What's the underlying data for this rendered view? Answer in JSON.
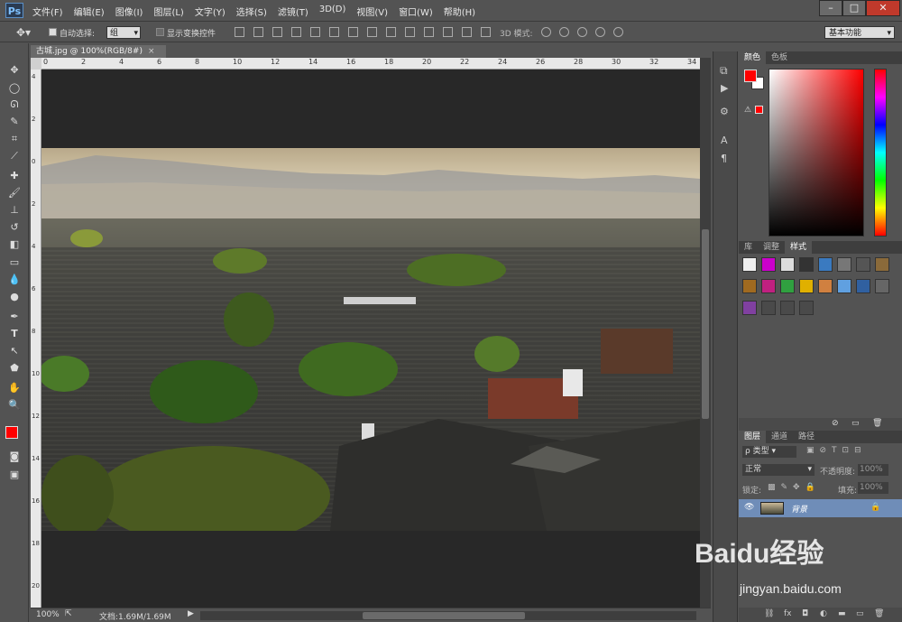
{
  "app": {
    "logo": "Ps"
  },
  "menu": [
    "文件(F)",
    "编辑(E)",
    "图像(I)",
    "图层(L)",
    "文字(Y)",
    "选择(S)",
    "滤镜(T)",
    "3D(D)",
    "视图(V)",
    "窗口(W)",
    "帮助(H)"
  ],
  "window_controls": {
    "minimize": "–",
    "restore": "□",
    "close": "✕"
  },
  "options": {
    "auto_select_label": "自动选择:",
    "auto_select_value": "组",
    "show_transform_label": "显示变换控件",
    "mode3d_label": "3D 模式:",
    "workspace": "基本功能"
  },
  "document": {
    "tab_title": "古城.jpg @ 100%(RGB/8#)",
    "ruler_h": [
      "0",
      "2",
      "4",
      "6",
      "8",
      "10",
      "12",
      "14",
      "16",
      "18",
      "20",
      "22",
      "24",
      "26",
      "28",
      "30",
      "32",
      "34"
    ],
    "ruler_v": [
      "4",
      "2",
      "0",
      "2",
      "4",
      "6",
      "8",
      "10",
      "12",
      "14",
      "16",
      "18",
      "20"
    ]
  },
  "status": {
    "zoom": "100%",
    "doc_size": "文档:1.69M/1.69M"
  },
  "color_panel": {
    "tabs": [
      "颜色",
      "色板"
    ],
    "foreground": "#ff0000",
    "background": "#ffffff"
  },
  "styles_panel": {
    "tabs": [
      "库",
      "调整",
      "样式"
    ]
  },
  "layers_panel": {
    "tabs": [
      "图层",
      "通道",
      "路径"
    ],
    "filter_label": "ρ 类型",
    "blend_mode": "正常",
    "opacity_label": "不透明度:",
    "opacity_value": "100%",
    "lock_label": "锁定:",
    "fill_label": "填充:",
    "fill_value": "100%",
    "layer_name": "背景"
  },
  "watermark": {
    "brand": "Baidu经验",
    "url": "jingyan.baidu.com"
  }
}
